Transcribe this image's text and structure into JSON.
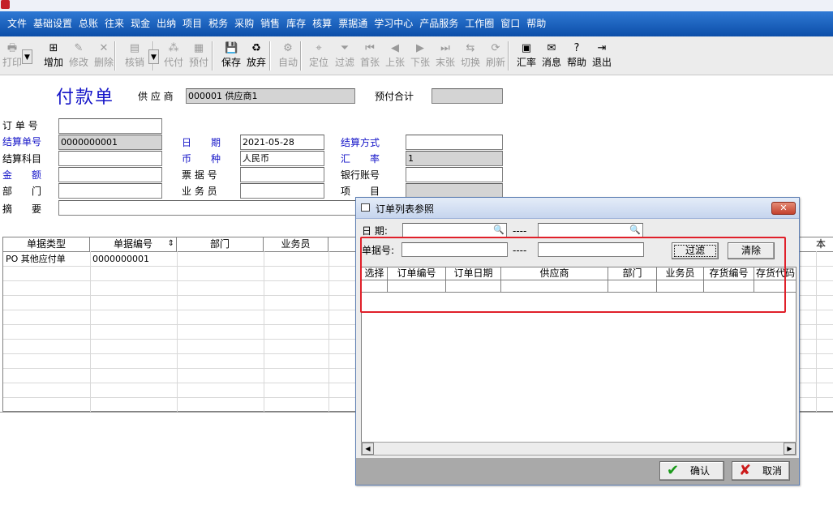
{
  "menu": [
    "文件",
    "基础设置",
    "总账",
    "往来",
    "现金",
    "出纳",
    "项目",
    "税务",
    "采购",
    "销售",
    "库存",
    "核算",
    "票据通",
    "学习中心",
    "产品服务",
    "工作圈",
    "窗口",
    "帮助"
  ],
  "toolbar": [
    {
      "label": "打印",
      "icon": "printer-icon",
      "glyph": "🖶",
      "enabled": false
    },
    {
      "label": "增加",
      "icon": "add-icon",
      "glyph": "⊞",
      "enabled": true
    },
    {
      "label": "修改",
      "icon": "edit-icon",
      "glyph": "✎",
      "enabled": false
    },
    {
      "label": "删除",
      "icon": "delete-icon",
      "glyph": "✕",
      "enabled": false
    },
    {
      "label": "核销",
      "icon": "verify-icon",
      "glyph": "▤",
      "enabled": false
    },
    {
      "label": "代付",
      "icon": "proxy-pay-icon",
      "glyph": "⁂",
      "enabled": false
    },
    {
      "label": "预付",
      "icon": "prepay-icon",
      "glyph": "▦",
      "enabled": false
    },
    {
      "label": "保存",
      "icon": "save-icon",
      "glyph": "💾",
      "enabled": true
    },
    {
      "label": "放弃",
      "icon": "discard-icon",
      "glyph": "♻",
      "enabled": true
    },
    {
      "label": "自动",
      "icon": "auto-icon",
      "glyph": "⚙",
      "enabled": false
    },
    {
      "label": "定位",
      "icon": "locate-icon",
      "glyph": "⌖",
      "enabled": false
    },
    {
      "label": "过滤",
      "icon": "filter-icon",
      "glyph": "⏷",
      "enabled": false
    },
    {
      "label": "首张",
      "icon": "first-icon",
      "glyph": "⏮",
      "enabled": false
    },
    {
      "label": "上张",
      "icon": "prev-icon",
      "glyph": "◀",
      "enabled": false
    },
    {
      "label": "下张",
      "icon": "next-icon",
      "glyph": "▶",
      "enabled": false
    },
    {
      "label": "末张",
      "icon": "last-icon",
      "glyph": "⏭",
      "enabled": false
    },
    {
      "label": "切换",
      "icon": "switch-icon",
      "glyph": "⇆",
      "enabled": false
    },
    {
      "label": "刷新",
      "icon": "refresh-icon",
      "glyph": "⟳",
      "enabled": false
    },
    {
      "label": "汇率",
      "icon": "exchange-rate-icon",
      "glyph": "▣",
      "enabled": true
    },
    {
      "label": "消息",
      "icon": "message-icon",
      "glyph": "✉",
      "enabled": true
    },
    {
      "label": "帮助",
      "icon": "help-icon",
      "glyph": "?",
      "enabled": true
    },
    {
      "label": "退出",
      "icon": "exit-icon",
      "glyph": "⇥",
      "enabled": true
    }
  ],
  "form": {
    "title": "付款单",
    "supplier_label": "供 应 商",
    "supplier_value": "000001   供应商1",
    "prepay_total_label": "预付合计",
    "prepay_total_value": "",
    "order_no_label": "订 单 号",
    "order_no_value": "",
    "settle_no_label": "结算单号",
    "settle_no_value": "0000000001",
    "date_label": "日　　期",
    "date_value": "2021-05-28",
    "settle_method_label": "结算方式",
    "settle_method_value": "",
    "settle_subject_label": "结算科目",
    "settle_subject_value": "",
    "currency_label": "币　　种",
    "currency_value": "人民币",
    "rate_label": "汇　　率",
    "rate_value": "1",
    "amount_label": "金　　额",
    "amount_value": "",
    "bill_no_label": "票 据 号",
    "bill_no_value": "",
    "bank_account_label": "银行账号",
    "bank_account_value": "",
    "dept_label": "部　　门",
    "dept_value": "",
    "salesman_label": "业 务 员",
    "salesman_value": "",
    "project_label": "项　　目",
    "project_value": "",
    "remark_label": "摘　　要",
    "remark_value": ""
  },
  "main_grid": {
    "headers": [
      "单据类型",
      "单据编号",
      "部门",
      "业务员",
      "本币"
    ],
    "rows": [
      [
        "PO  其他应付单",
        "0000000001",
        "",
        ""
      ]
    ]
  },
  "dialog": {
    "title": "订单列表参照",
    "date_label": "日  期:",
    "date_from": "",
    "dash1": "----",
    "date_to": "",
    "doc_no_label": "单据号:",
    "doc_no_from": "",
    "dash2": "----",
    "doc_no_to": "",
    "filter_label": "过滤",
    "clear_label": "清除",
    "headers": [
      "选择",
      "订单编号",
      "订单日期",
      "供应商",
      "部门",
      "业务员",
      "存货编号",
      "存货代码"
    ],
    "ok_label": "确认",
    "cancel_label": "取消"
  }
}
